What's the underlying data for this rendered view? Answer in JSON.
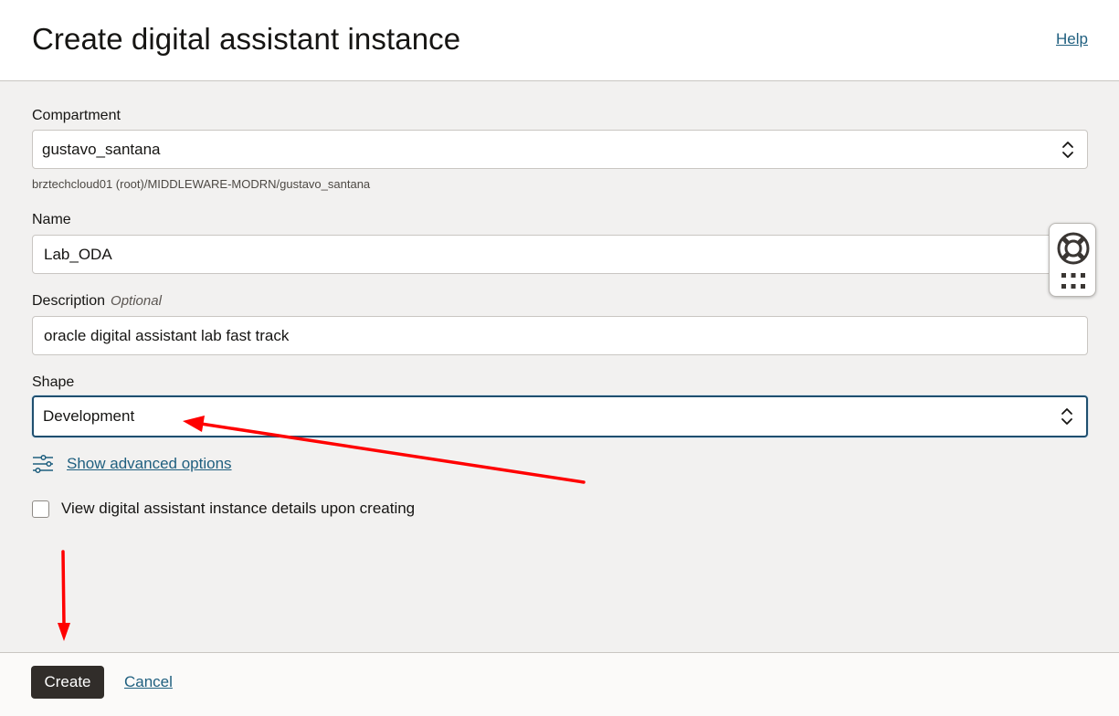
{
  "header": {
    "title": "Create digital assistant instance",
    "help_link": "Help"
  },
  "form": {
    "compartment": {
      "label": "Compartment",
      "value": "gustavo_santana",
      "hint": "brztechcloud01 (root)/MIDDLEWARE-MODRN/gustavo_santana"
    },
    "name": {
      "label": "Name",
      "value": "Lab_ODA"
    },
    "description": {
      "label": "Description",
      "optional": "Optional",
      "value": "oracle digital assistant lab fast track"
    },
    "shape": {
      "label": "Shape",
      "value": "Development"
    },
    "advanced_options_link": "Show advanced options",
    "view_details_checkbox": {
      "label": "View digital assistant instance details upon creating",
      "checked": false
    }
  },
  "footer": {
    "create_label": "Create",
    "cancel_label": "Cancel"
  },
  "icons": {
    "select": "chevron-up-down-icon",
    "advanced": "sliders-icon",
    "widget_top": "lifebuoy-icon",
    "widget_bottom": "apps-grid-icon"
  },
  "colors": {
    "link": "#1f5f7f",
    "primary_button": "#312d2a",
    "focus_border": "#1f4f6f",
    "annotation_arrow": "#ff0000"
  }
}
